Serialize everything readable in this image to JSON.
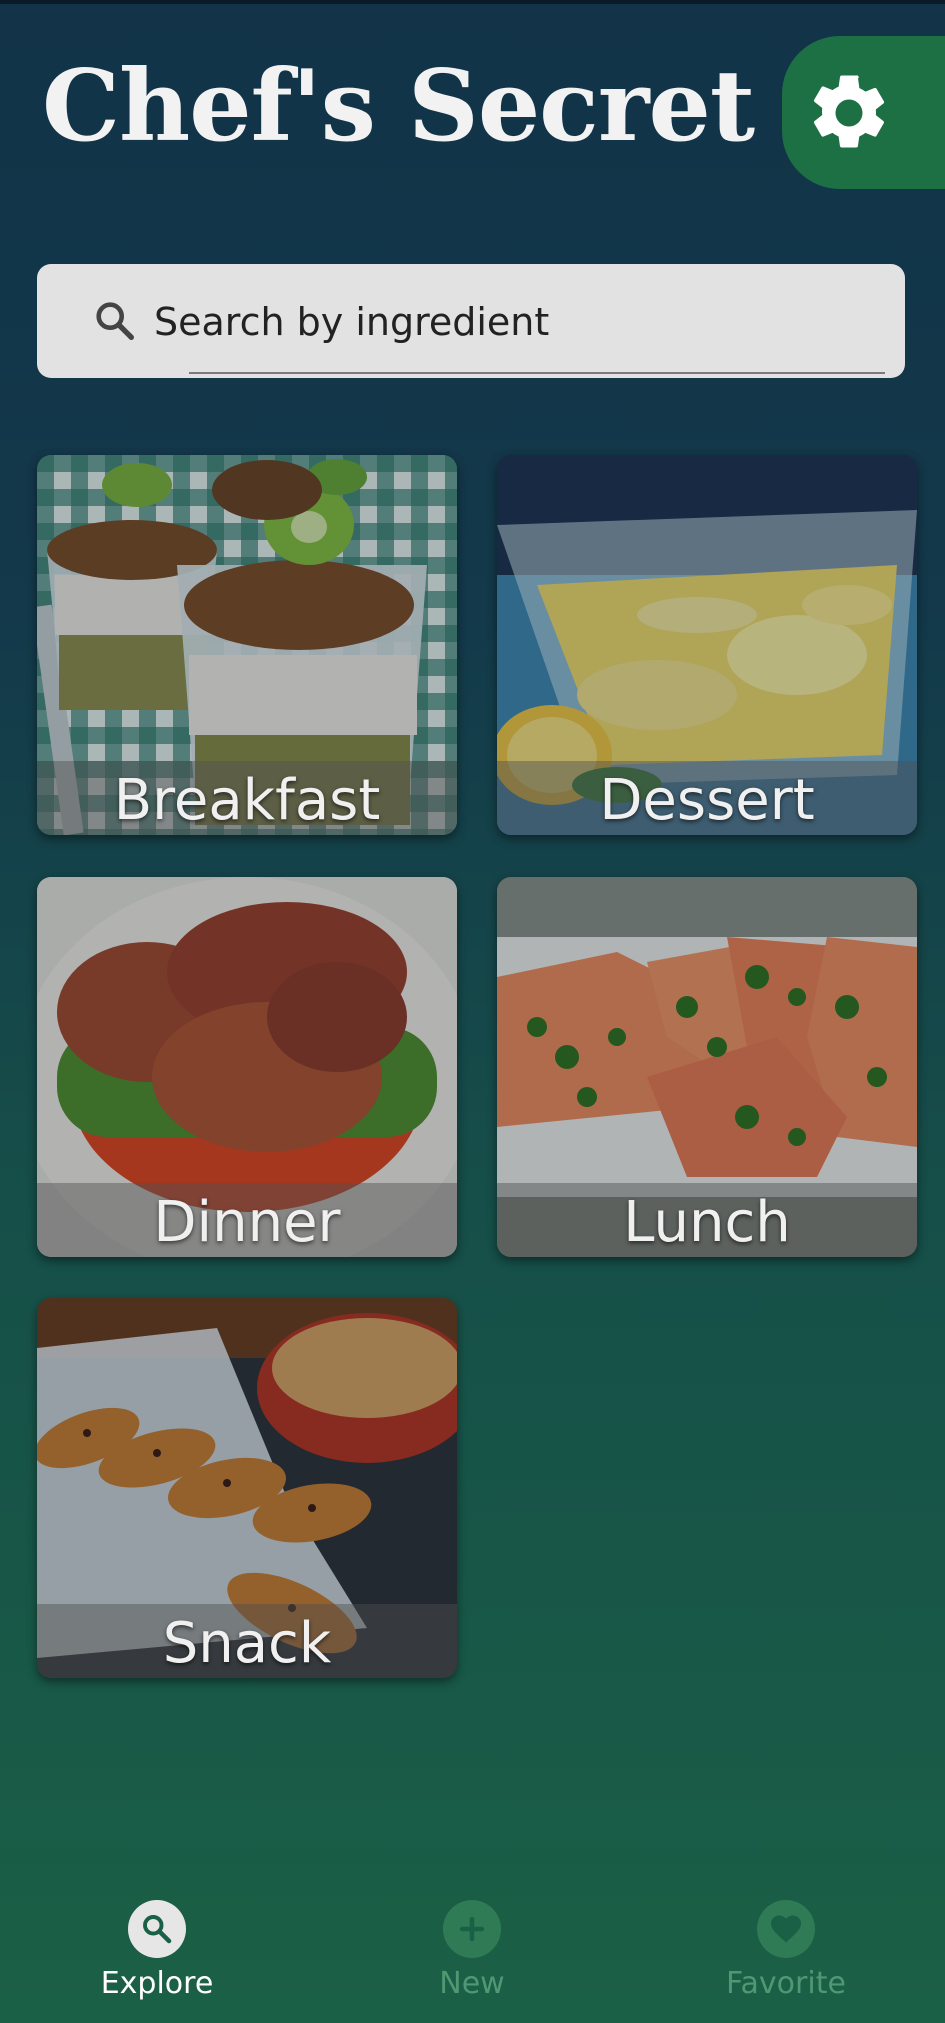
{
  "app": {
    "title": "Chef's Secret"
  },
  "header": {
    "settings_icon": "gear-icon"
  },
  "search": {
    "placeholder": "Search by ingredient",
    "value": ""
  },
  "categories": [
    {
      "label": "Breakfast"
    },
    {
      "label": "Dessert"
    },
    {
      "label": "Dinner"
    },
    {
      "label": "Lunch"
    },
    {
      "label": "Snack"
    }
  ],
  "bottom_nav": {
    "items": [
      {
        "label": "Explore",
        "icon": "search-icon",
        "active": true
      },
      {
        "label": "New",
        "icon": "plus-icon",
        "active": false
      },
      {
        "label": "Favorite",
        "icon": "heart-icon",
        "active": false
      }
    ]
  },
  "colors": {
    "background_top": "#123348",
    "background_bottom": "#1a6046",
    "accent_green": "#1c7044",
    "active_nav": "#ffffff",
    "inactive_nav": "#4f9873"
  }
}
